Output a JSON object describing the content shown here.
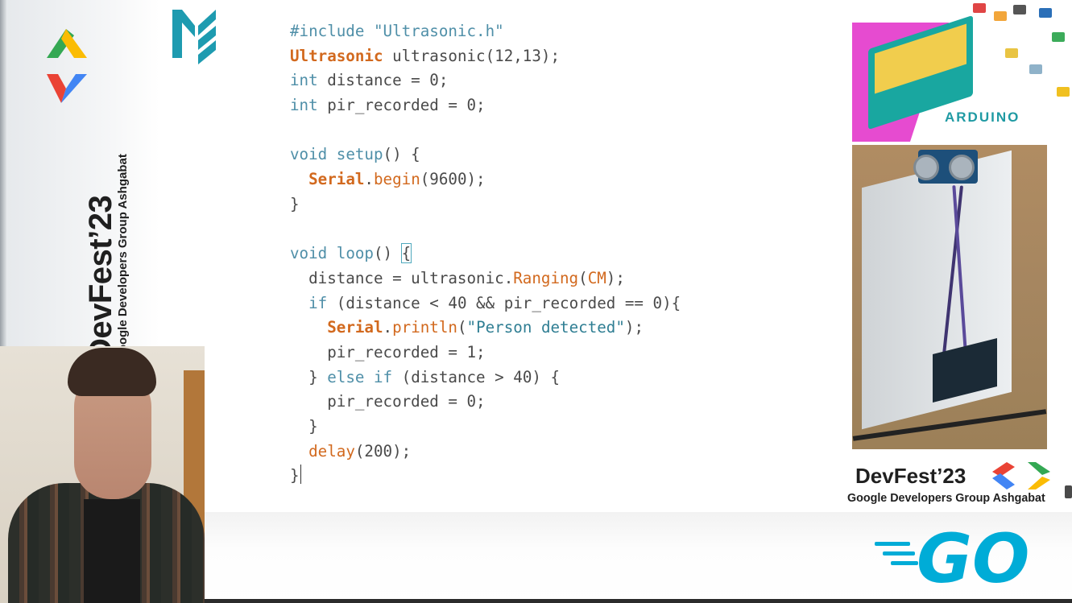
{
  "code": {
    "lines": [
      [
        {
          "t": "#include \"Ultrasonic.h\"",
          "c": "inc"
        }
      ],
      [
        {
          "t": "Ultrasonic",
          "c": "c"
        },
        {
          "t": " ultrasonic(12,13);",
          "c": "d"
        }
      ],
      [
        {
          "t": "int",
          "c": "k"
        },
        {
          "t": " distance = 0;",
          "c": "d"
        }
      ],
      [
        {
          "t": "int",
          "c": "k"
        },
        {
          "t": " pir_recorded = 0;",
          "c": "d"
        }
      ],
      [],
      [
        {
          "t": "void",
          "c": "k"
        },
        {
          "t": " setup",
          "c": "k"
        },
        {
          "t": "() {",
          "c": "d"
        }
      ],
      [
        {
          "t": "  ",
          "c": "d"
        },
        {
          "t": "Serial",
          "c": "c"
        },
        {
          "t": ".",
          "c": "d"
        },
        {
          "t": "begin",
          "c": "f"
        },
        {
          "t": "(9600);",
          "c": "d"
        }
      ],
      [
        {
          "t": "}",
          "c": "d"
        }
      ],
      [],
      [
        {
          "t": "void",
          "c": "k"
        },
        {
          "t": " loop",
          "c": "k"
        },
        {
          "t": "() ",
          "c": "d"
        },
        {
          "t": "{",
          "c": "d",
          "box": true
        }
      ],
      [
        {
          "t": "  distance = ultrasonic.",
          "c": "d"
        },
        {
          "t": "Ranging",
          "c": "f"
        },
        {
          "t": "(",
          "c": "d"
        },
        {
          "t": "CM",
          "c": "f"
        },
        {
          "t": ");",
          "c": "d"
        }
      ],
      [
        {
          "t": "  ",
          "c": "d"
        },
        {
          "t": "if",
          "c": "k"
        },
        {
          "t": " (distance < 40 && pir_recorded == 0){",
          "c": "d"
        }
      ],
      [
        {
          "t": "    ",
          "c": "d"
        },
        {
          "t": "Serial",
          "c": "c"
        },
        {
          "t": ".",
          "c": "d"
        },
        {
          "t": "println",
          "c": "f"
        },
        {
          "t": "(",
          "c": "d"
        },
        {
          "t": "\"Person detected\"",
          "c": "s"
        },
        {
          "t": ");",
          "c": "d"
        }
      ],
      [
        {
          "t": "    pir_recorded = 1;",
          "c": "d"
        }
      ],
      [
        {
          "t": "  } ",
          "c": "d"
        },
        {
          "t": "else if",
          "c": "k"
        },
        {
          "t": " (distance > 40) {",
          "c": "d"
        }
      ],
      [
        {
          "t": "    pir_recorded = 0;",
          "c": "d"
        }
      ],
      [
        {
          "t": "  }",
          "c": "d"
        }
      ],
      [
        {
          "t": "  ",
          "c": "d"
        },
        {
          "t": "delay",
          "c": "f"
        },
        {
          "t": "(200);",
          "c": "d"
        }
      ],
      [
        {
          "t": "}",
          "c": "d",
          "caret": true
        }
      ]
    ]
  },
  "branding": {
    "devfest_title": "DevFest’23",
    "devfest_subtitle": "Google Developers Group Ashgabat",
    "arduino_label": "ARDUINO",
    "go_logo": "GO"
  },
  "colors": {
    "keyword": "#4f8fa8",
    "class": "#d2691e",
    "string": "#2f7e93",
    "go_cyan": "#00acd7",
    "df_green": "#34a853",
    "df_yellow": "#fbbc04",
    "df_red": "#ea4335",
    "df_blue": "#4285f4"
  },
  "icons": {
    "m_logo": "meetup-style-m-icon",
    "devfest_chevrons": "chevron-brackets-icon"
  }
}
